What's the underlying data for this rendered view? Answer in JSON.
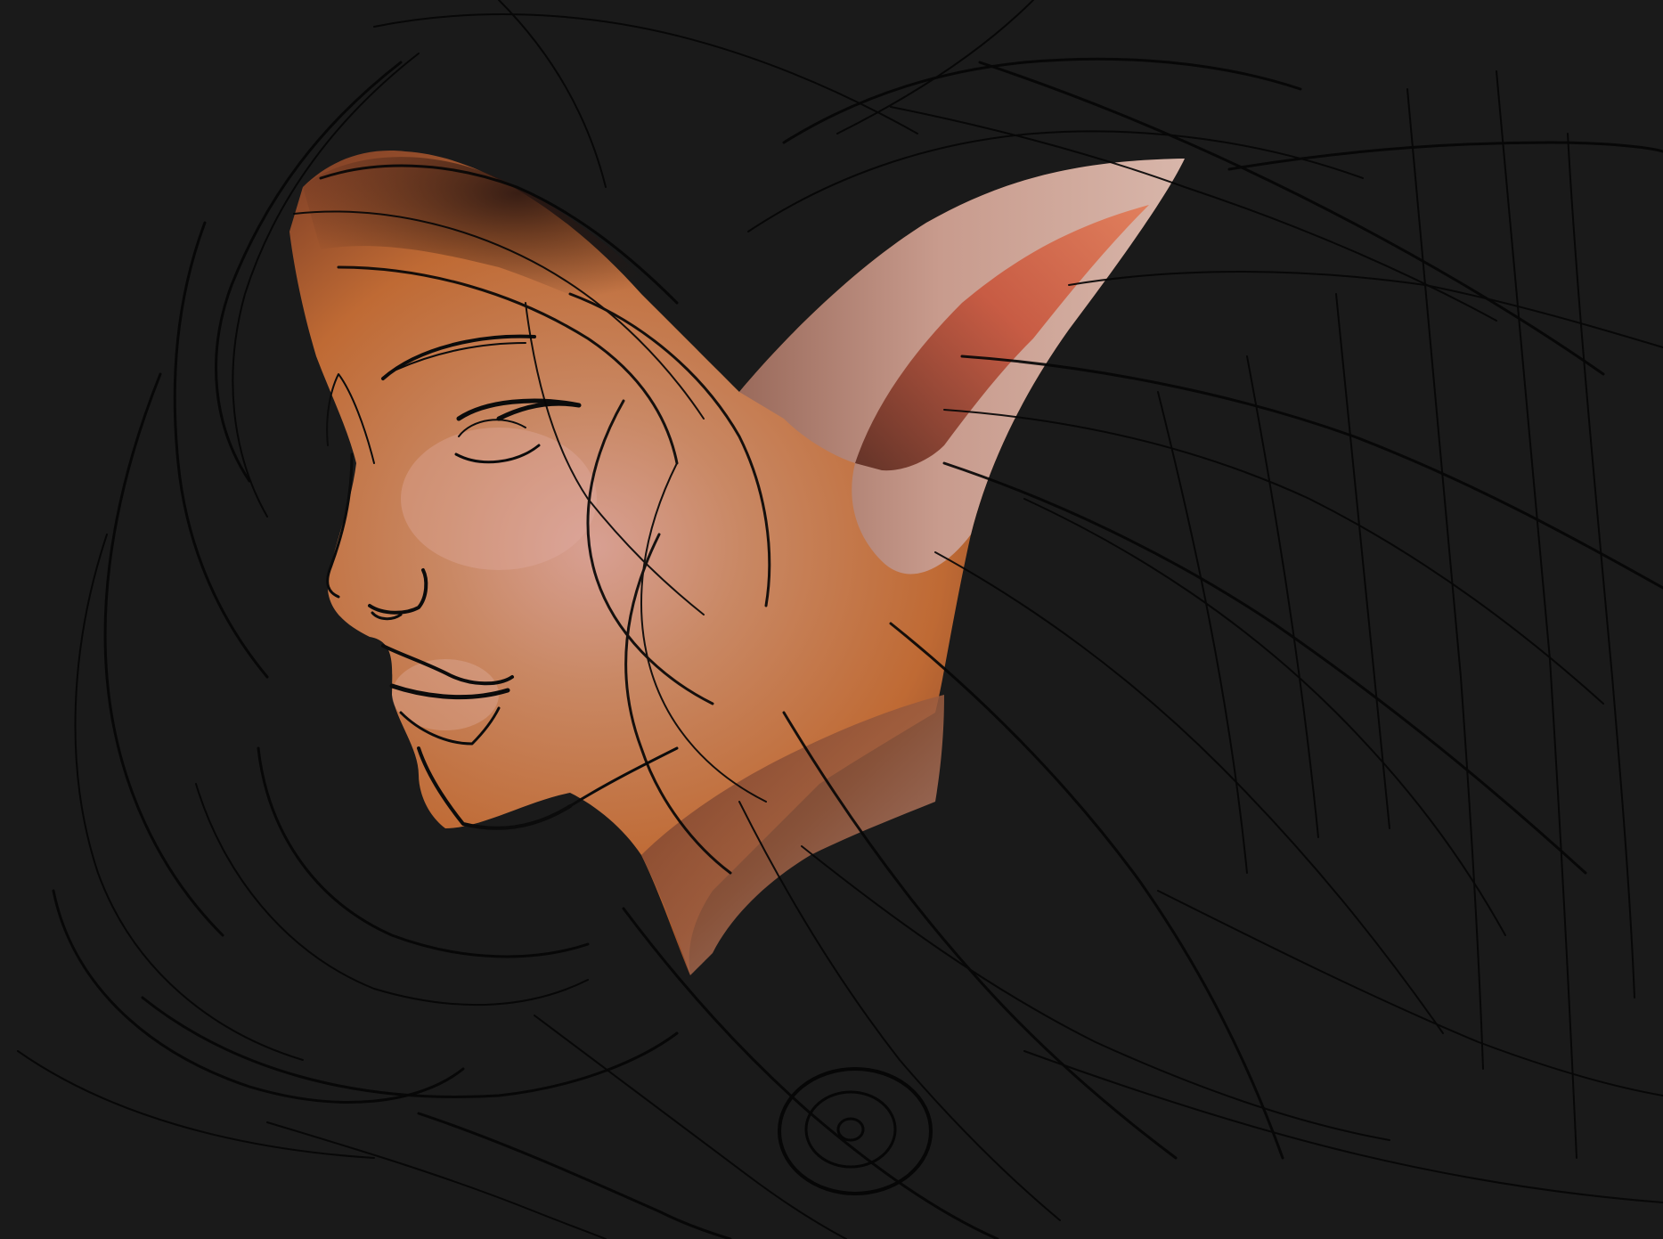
{
  "artwork": {
    "background": "#1a1a1a",
    "skin_light": "#c9968a",
    "skin_mid": "#b56a3c",
    "skin_warm": "#d0702f",
    "skin_shadow": "#4f2a1f",
    "line": "#0b0b0b"
  }
}
